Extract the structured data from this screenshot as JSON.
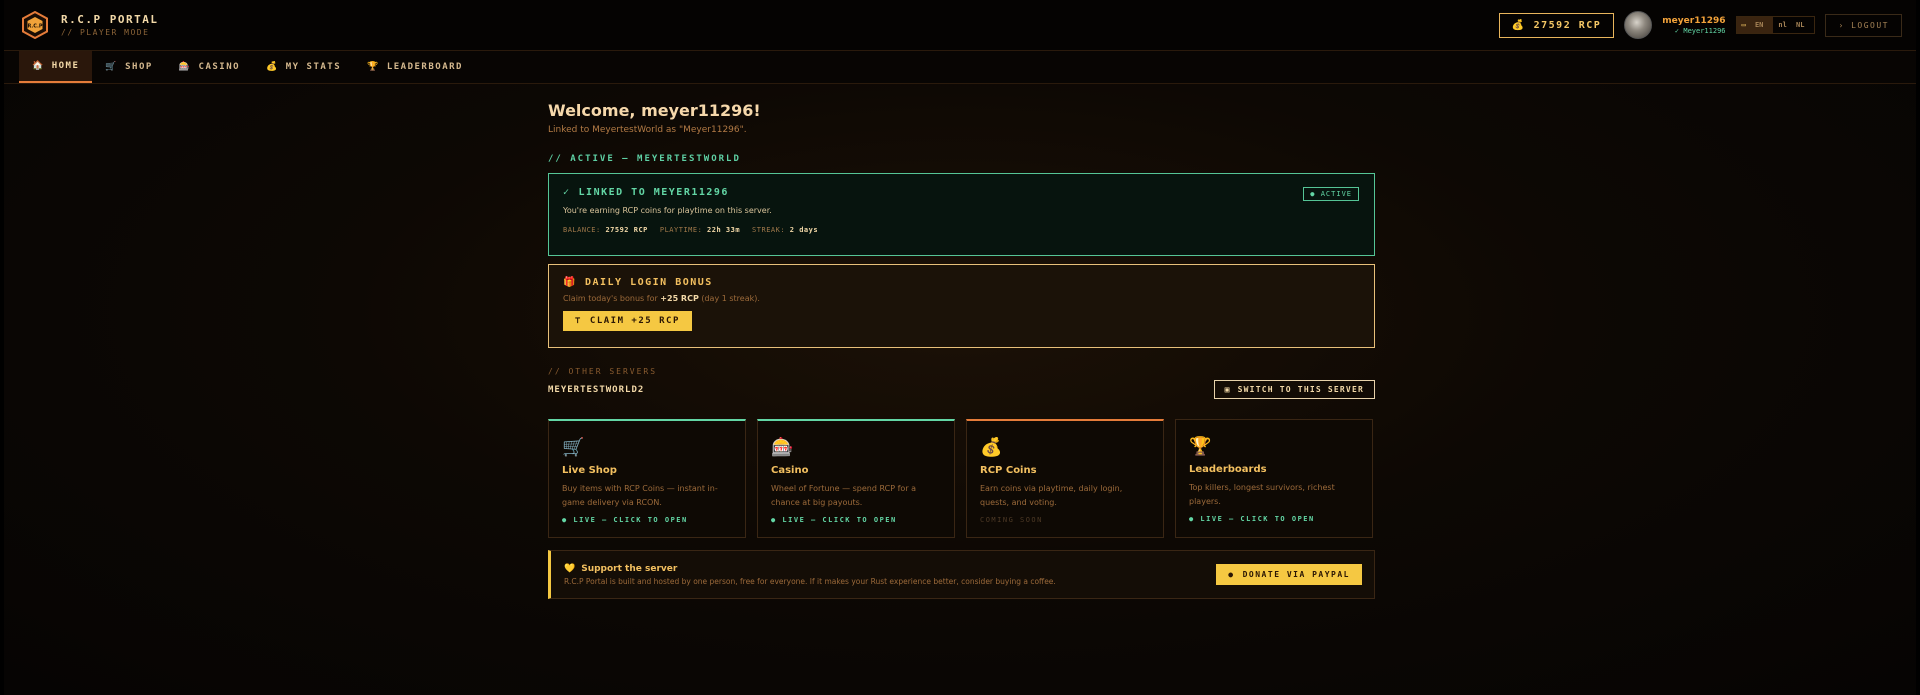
{
  "brand": {
    "title": "R.C.P PORTAL",
    "subtitle": "// PLAYER MODE",
    "logo_text": "R.C.P"
  },
  "header": {
    "balance": "27592 RCP",
    "balance_icon": "money-bag-icon",
    "username": "meyer11296",
    "linked_name": "✓ Meyer11296",
    "languages": [
      "EN",
      "NL"
    ],
    "active_language": "EN",
    "logout_label": "› LOGOUT"
  },
  "nav": {
    "items": [
      {
        "label": "HOME",
        "icon": "home-icon",
        "glyph": "⌂",
        "active": true
      },
      {
        "label": "SHOP",
        "icon": "cart-icon",
        "glyph": "🛒",
        "active": false
      },
      {
        "label": "CASINO",
        "icon": "slot-machine-icon",
        "glyph": "🎰",
        "active": false
      },
      {
        "label": "MY STATS",
        "icon": "money-bag-icon",
        "glyph": "💰",
        "active": false
      },
      {
        "label": "LEADERBOARD",
        "icon": "trophy-icon",
        "glyph": "🏆",
        "active": false
      }
    ]
  },
  "welcome": {
    "title": "Welcome, meyer11296!",
    "linked_text": "Linked to MeyertestWorld as \"Meyer11296\"."
  },
  "active_section": {
    "label": "// ACTIVE — MEYERTESTWORLD",
    "card_title": "LINKED TO MEYER11296",
    "badge": "● ACTIVE",
    "description": "You're earning RCP coins for playtime on this server.",
    "balance_label": "BALANCE:",
    "balance_value": "27592 RCP",
    "playtime_label": "PLAYTIME:",
    "playtime_value": "22h 33m",
    "streak_label": "STREAK:",
    "streak_value": "2 days"
  },
  "bonus": {
    "title": "DAILY LOGIN BONUS",
    "desc_prefix": "Claim today's bonus for ",
    "desc_amount": "+25 RCP",
    "desc_suffix": " (day 1 streak).",
    "button_label": "CLAIM +25 RCP"
  },
  "other_servers": {
    "label": "// OTHER SERVERS",
    "server_name": "MEYERTESTWORLD2",
    "switch_label": "SWITCH TO THIS SERVER"
  },
  "cards": [
    {
      "title": "Live Shop",
      "icon": "cart-icon",
      "glyph": "🛒",
      "desc": "Buy items with RCP Coins — instant in-game delivery via RCON.",
      "status": "● LIVE — CLICK TO OPEN",
      "accent": "green",
      "soon": false
    },
    {
      "title": "Casino",
      "icon": "slot-machine-icon",
      "glyph": "🎰",
      "desc": "Wheel of Fortune — spend RCP for a chance at big payouts.",
      "status": "● LIVE — CLICK TO OPEN",
      "accent": "green",
      "soon": false
    },
    {
      "title": "RCP Coins",
      "icon": "money-bag-icon",
      "glyph": "💰",
      "desc": "Earn coins via playtime, daily login, quests, and voting.",
      "status": "COMING SOON",
      "accent": "orange",
      "soon": true
    },
    {
      "title": "Leaderboards",
      "icon": "trophy-icon",
      "glyph": "🏆",
      "desc": "Top killers, longest survivors, richest players.",
      "status": "● LIVE — CLICK TO OPEN",
      "accent": "none",
      "soon": false
    }
  ],
  "support": {
    "title": "Support the server",
    "desc": "R.C.P Portal is built and hosted by one person, free for everyone. If it makes your Rust experience better, consider buying a coffee.",
    "button_label": "DONATE VIA PAYPAL"
  },
  "colors": {
    "accent_gold": "#f5c842",
    "accent_green": "#63d6a5",
    "accent_orange": "#e57c3a",
    "background": "#0d0804"
  }
}
